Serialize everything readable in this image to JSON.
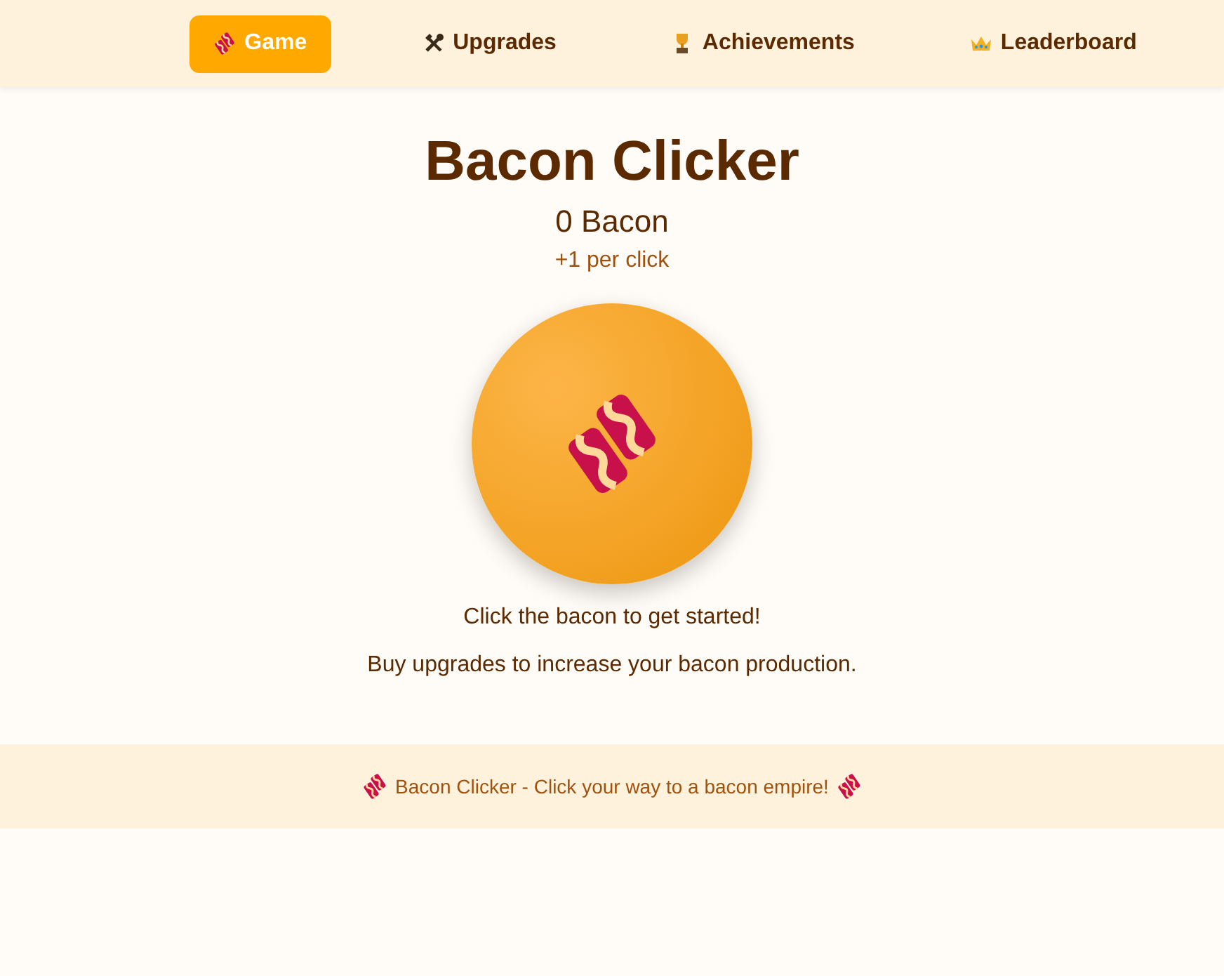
{
  "nav": {
    "tabs": [
      {
        "label": "Game",
        "kind": "bacon",
        "selected": true
      },
      {
        "label": "Upgrades",
        "kind": "tools",
        "selected": false
      },
      {
        "label": "Achievements",
        "kind": "trophy",
        "selected": false
      },
      {
        "label": "Leaderboard",
        "kind": "crown",
        "selected": false
      }
    ]
  },
  "game": {
    "title": "Bacon Clicker",
    "count": "0 Bacon",
    "rate": "+1 per click",
    "hints": [
      "Click the bacon to get started!",
      "Buy upgrades to increase your bacon production."
    ]
  },
  "footer": {
    "text": "Bacon Clicker - Click your way to a bacon empire!"
  }
}
